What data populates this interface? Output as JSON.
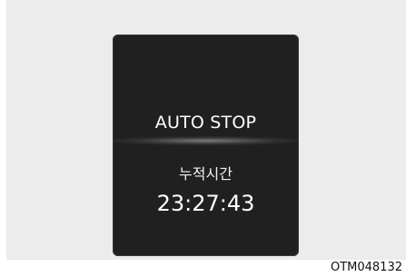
{
  "display": {
    "mode_text": "AUTO STOP",
    "label_text": "누적시간",
    "time_value": "23:27:43"
  },
  "figure": {
    "code": "OTM048132"
  }
}
